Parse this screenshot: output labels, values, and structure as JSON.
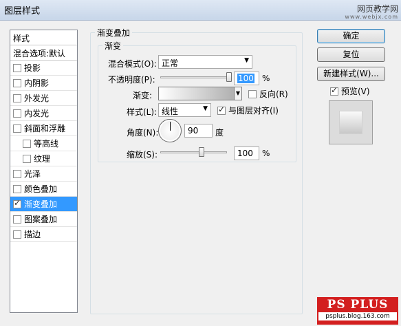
{
  "window": {
    "title": "图层样式"
  },
  "watermark": {
    "line1": "网页教学网",
    "line2": "www.webjx.com"
  },
  "stylelist": {
    "header": "样式",
    "blend_default": "混合选项:默认",
    "items": [
      {
        "label": "投影",
        "checked": false,
        "sub": false,
        "selected": false
      },
      {
        "label": "内阴影",
        "checked": false,
        "sub": false,
        "selected": false
      },
      {
        "label": "外发光",
        "checked": false,
        "sub": false,
        "selected": false
      },
      {
        "label": "内发光",
        "checked": false,
        "sub": false,
        "selected": false
      },
      {
        "label": "斜面和浮雕",
        "checked": false,
        "sub": false,
        "selected": false
      },
      {
        "label": "等高线",
        "checked": false,
        "sub": true,
        "selected": false
      },
      {
        "label": "纹理",
        "checked": false,
        "sub": true,
        "selected": false
      },
      {
        "label": "光泽",
        "checked": false,
        "sub": false,
        "selected": false
      },
      {
        "label": "颜色叠加",
        "checked": false,
        "sub": false,
        "selected": false
      },
      {
        "label": "渐变叠加",
        "checked": true,
        "sub": false,
        "selected": true
      },
      {
        "label": "图案叠加",
        "checked": false,
        "sub": false,
        "selected": false
      },
      {
        "label": "描边",
        "checked": false,
        "sub": false,
        "selected": false
      }
    ]
  },
  "panel": {
    "outer_title": "渐变叠加",
    "inner_title": "渐变",
    "blend_mode_label": "混合模式(O):",
    "blend_mode_value": "正常",
    "opacity_label": "不透明度(P):",
    "opacity_value": "100",
    "opacity_unit": "%",
    "gradient_label": "渐变:",
    "reverse_label": "反向(R)",
    "reverse_checked": false,
    "style_label": "样式(L):",
    "style_value": "线性",
    "align_label": "与图层对齐(I)",
    "align_checked": true,
    "angle_label": "角度(N):",
    "angle_value": "90",
    "angle_unit": "度",
    "scale_label": "缩放(S):",
    "scale_value": "100",
    "scale_unit": "%",
    "opacity_level_percent": 100,
    "scale_level_percent": 100
  },
  "buttons": {
    "ok": "确定",
    "reset": "复位",
    "new_style": "新建样式(W)...",
    "preview_label": "预览(V)",
    "preview_checked": true
  },
  "logo": {
    "main": "PS PLUS",
    "sub": "psplus.blog.163.com"
  },
  "colors": {
    "selection": "#3399ff",
    "logo_red": "#d31f1f"
  }
}
